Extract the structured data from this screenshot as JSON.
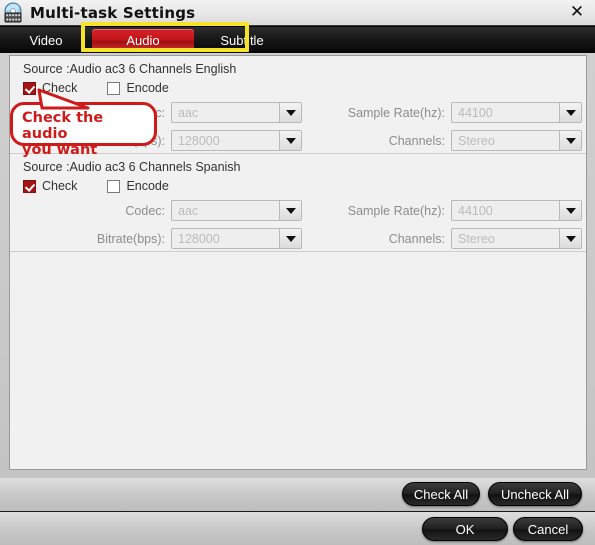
{
  "window": {
    "title": "Multi-task Settings",
    "icon": "disc-film-icon",
    "close_label": "✕"
  },
  "tabs": [
    {
      "id": "video",
      "label": "Video",
      "active": false
    },
    {
      "id": "audio",
      "label": "Audio",
      "active": true
    },
    {
      "id": "subtitle",
      "label": "Subtitle",
      "active": false
    }
  ],
  "highlight": {
    "color": "#f5e32a",
    "target": "audio-and-subtitle-tabs"
  },
  "callout": {
    "line1": "Check the audio",
    "line2": "you want",
    "color": "#cf1a1a"
  },
  "tracks": [
    {
      "source_line": "Source :Audio  ac3  6 Channels  English",
      "check_label": "Check",
      "checked": true,
      "encode_label": "Encode",
      "encoded": false,
      "fields": {
        "codec_label": "Codec:",
        "codec_value": "aac",
        "bitrate_label": "Bitrate(bps):",
        "bitrate_value": "128000",
        "samplerate_label": "Sample Rate(hz):",
        "samplerate_value": "44100",
        "channels_label": "Channels:",
        "channels_value": "Stereo"
      }
    },
    {
      "source_line": "Source :Audio  ac3  6 Channels  Spanish",
      "check_label": "Check",
      "checked": true,
      "encode_label": "Encode",
      "encoded": false,
      "fields": {
        "codec_label": "Codec:",
        "codec_value": "aac",
        "bitrate_label": "Bitrate(bps):",
        "bitrate_value": "128000",
        "samplerate_label": "Sample Rate(hz):",
        "samplerate_value": "44100",
        "channels_label": "Channels:",
        "channels_value": "Stereo"
      }
    }
  ],
  "buttons": {
    "check_all": "Check All",
    "uncheck_all": "Uncheck All",
    "ok": "OK",
    "cancel": "Cancel"
  },
  "colors": {
    "accent_red": "#c2181d",
    "highlight_yellow": "#f5e32a",
    "callout_red": "#cf1a1a",
    "checkbox_red": "#a31515"
  }
}
